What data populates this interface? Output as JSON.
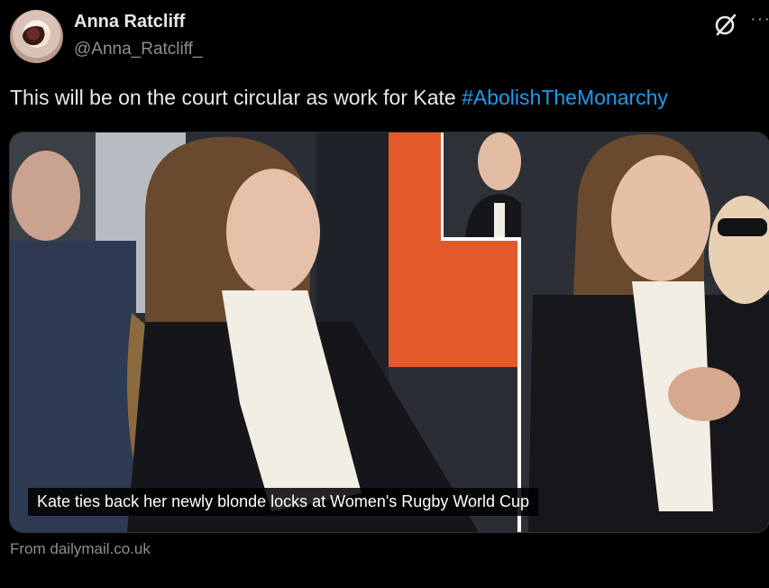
{
  "post": {
    "author_name": "Anna Ratcliff",
    "author_handle": "@Anna_Ratcliff_",
    "text_prefix": "This will be on the court circular as work for Kate ",
    "hashtag": "#AbolishTheMonarchy",
    "more_label": "···",
    "icons": {
      "top_right": "grok-slash-icon",
      "more": "more-dots-icon",
      "avatar": "avatar-image"
    }
  },
  "card": {
    "caption": "Kate ties back her newly blonde locks at Women's Rugby World Cup",
    "source": "From dailymail.co.uk"
  },
  "colors": {
    "background": "#000000",
    "text": "#e7e9ea",
    "muted": "#8b9095",
    "link": "#1d9bf0"
  }
}
